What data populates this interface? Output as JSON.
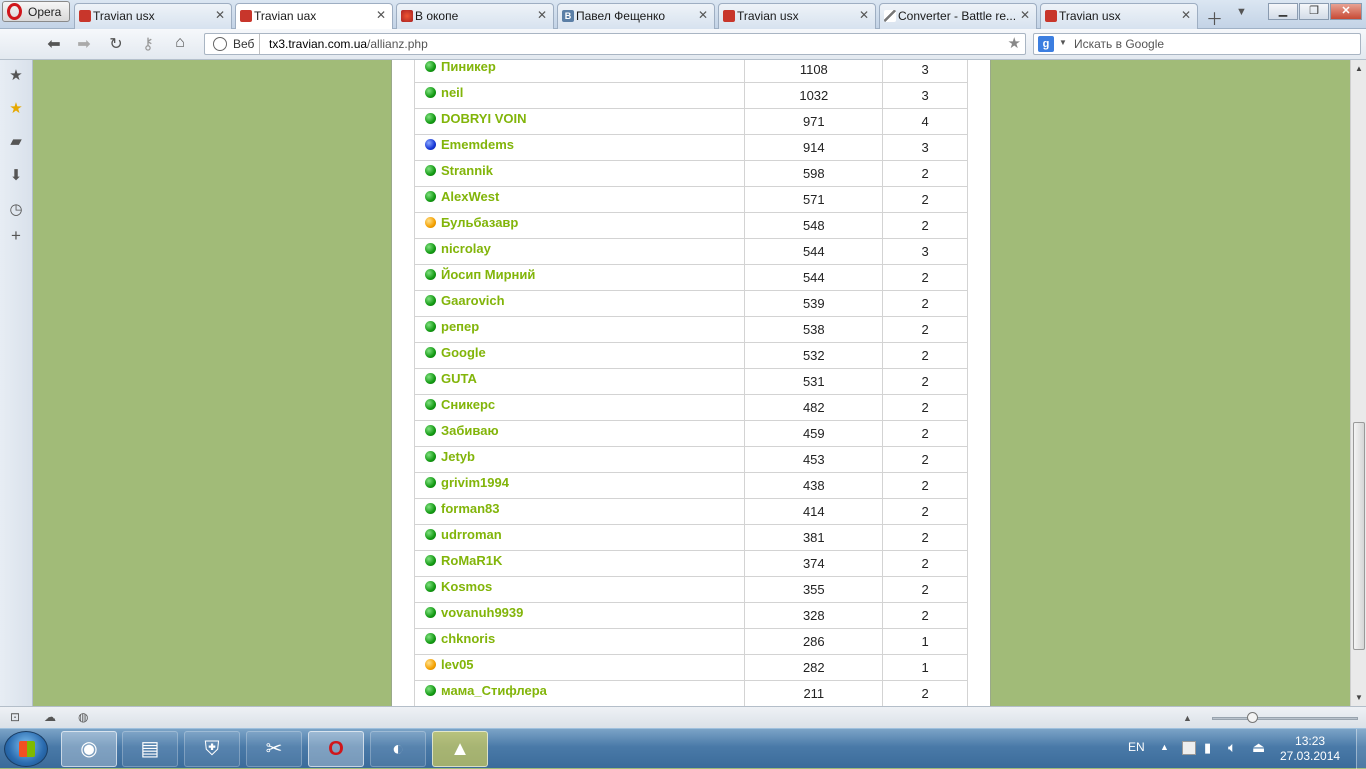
{
  "browser": {
    "menu_label": "Opera",
    "tabs": [
      {
        "title": "Travian usx",
        "icon": "travian-favicon",
        "active": false
      },
      {
        "title": "Travian uax",
        "icon": "travian-favicon",
        "active": true
      },
      {
        "title": "В окопе",
        "icon": "okope-favicon",
        "active": false
      },
      {
        "title": "Павел Фещенко",
        "icon": "vk-favicon",
        "active": false
      },
      {
        "title": "Travian usx",
        "icon": "travian-favicon",
        "active": false
      },
      {
        "title": "Converter - Battle re...",
        "icon": "sword-favicon",
        "active": false
      },
      {
        "title": "Travian usx",
        "icon": "travian-favicon",
        "active": false
      }
    ],
    "vk_favicon_letter": "B",
    "address": {
      "prefix_label": "Веб",
      "url_host": "tx3.travian.com.ua",
      "url_path": "/allianz.php"
    },
    "search": {
      "placeholder": "Искать в Google",
      "engine_letter": "g"
    }
  },
  "players": [
    {
      "name": "Пиникер",
      "population": "1108",
      "villages": "3",
      "status": "green"
    },
    {
      "name": "neil",
      "population": "1032",
      "villages": "3",
      "status": "green"
    },
    {
      "name": "DOBRYI VOIN",
      "population": "971",
      "villages": "4",
      "status": "green"
    },
    {
      "name": "Ememdems",
      "population": "914",
      "villages": "3",
      "status": "blue"
    },
    {
      "name": "Strannik",
      "population": "598",
      "villages": "2",
      "status": "green"
    },
    {
      "name": "AlexWest",
      "population": "571",
      "villages": "2",
      "status": "green"
    },
    {
      "name": "Бульбазавр",
      "population": "548",
      "villages": "2",
      "status": "orange"
    },
    {
      "name": "nicrolay",
      "population": "544",
      "villages": "3",
      "status": "green"
    },
    {
      "name": "Йосип Мирний",
      "population": "544",
      "villages": "2",
      "status": "green"
    },
    {
      "name": "Gaarovich",
      "population": "539",
      "villages": "2",
      "status": "green"
    },
    {
      "name": "репер",
      "population": "538",
      "villages": "2",
      "status": "green"
    },
    {
      "name": "Google",
      "population": "532",
      "villages": "2",
      "status": "green"
    },
    {
      "name": "GUTA",
      "population": "531",
      "villages": "2",
      "status": "green"
    },
    {
      "name": "Сникерс",
      "population": "482",
      "villages": "2",
      "status": "green"
    },
    {
      "name": "Забиваю",
      "population": "459",
      "villages": "2",
      "status": "green"
    },
    {
      "name": "Jetyb",
      "population": "453",
      "villages": "2",
      "status": "green"
    },
    {
      "name": "grivim1994",
      "population": "438",
      "villages": "2",
      "status": "green"
    },
    {
      "name": "forman83",
      "population": "414",
      "villages": "2",
      "status": "green"
    },
    {
      "name": "udrroman",
      "population": "381",
      "villages": "2",
      "status": "green"
    },
    {
      "name": "RoMaR1K",
      "population": "374",
      "villages": "2",
      "status": "green"
    },
    {
      "name": "Kosmos",
      "population": "355",
      "villages": "2",
      "status": "green"
    },
    {
      "name": "vovanuh9939",
      "population": "328",
      "villages": "2",
      "status": "green"
    },
    {
      "name": "chknoris",
      "population": "286",
      "villages": "1",
      "status": "green"
    },
    {
      "name": "lev05",
      "population": "282",
      "villages": "1",
      "status": "orange"
    },
    {
      "name": "мама_Стифлера",
      "population": "211",
      "villages": "2",
      "status": "green"
    }
  ],
  "colors": {
    "page_background": "#a1bb78",
    "player_link": "#82b50a",
    "status_green": "#139a13",
    "status_blue": "#1636d6",
    "status_orange": "#f4a000"
  },
  "taskbar": {
    "apps": [
      "media-center-icon",
      "explorer-folder-icon",
      "security-shield-icon",
      "tools-icon",
      "opera-icon",
      "firefox-icon",
      "game-app-icon"
    ],
    "language": "EN",
    "time": "13:23",
    "date": "27.03.2014"
  }
}
